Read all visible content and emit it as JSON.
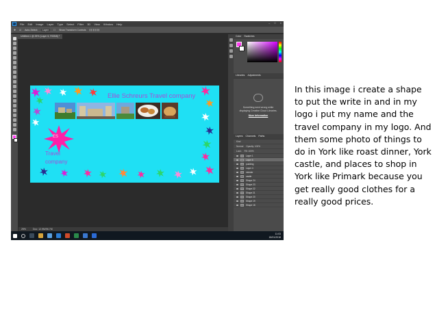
{
  "screenshot": {
    "menu_items": [
      "File",
      "Edit",
      "Image",
      "Layer",
      "Type",
      "Select",
      "Filter",
      "3D",
      "View",
      "Window",
      "Help"
    ],
    "options": {
      "auto_select": "Auto-Select:",
      "layer_value": "Layer",
      "show_transform": "Show Transform Controls"
    },
    "doc_tab": "Untitled-1 @ 25% (Layer 6, RGB/8) *",
    "status": {
      "zoom": "25%",
      "doc_info": "Doc: 12.9M/96.7M"
    },
    "canvas": {
      "company_title": "Ellie Schreurs Travel company",
      "logo_initials": "ES",
      "logo_line1": "Travel",
      "logo_line2": "company",
      "background_color": "#1fe0f4",
      "text_color": "#a64dd9"
    },
    "panels": {
      "color_tabs": [
        "Color",
        "Swatches"
      ],
      "adjust_tabs": [
        "Libraries",
        "Adjustments"
      ],
      "adjust_message": "Something went wrong while displaying Creative Cloud Libraries.",
      "adjust_link": "More Information",
      "layers_tabs": [
        "Layers",
        "Channels",
        "Paths"
      ],
      "layers_kind": "Kind",
      "blend_mode": "Normal",
      "opacity": "Opacity: 100%",
      "lock": "Lock:",
      "fill": "Fill: 100%",
      "layers": [
        "Layer 1",
        "Layer 6",
        "pudding",
        "Layer 4",
        "minster",
        "castle",
        "Shape 24",
        "Shape 23",
        "Shape 22",
        "Shape 21",
        "Shape 20",
        "Shape 19",
        "Shape 18"
      ]
    },
    "taskbar": {
      "time": "11:03",
      "date": "18/01/2018"
    }
  },
  "caption": {
    "text": "In this image i create a shape to put the write in and in my  logo  i put my name and the travel company  in my logo. And them some photo of things to do in York like roast dinner, York castle, and places to shop in York like Primark because you get really good clothes for a really good prices."
  },
  "colors": {
    "foreground_swatch": "#ff3df0",
    "canvas_cyan": "#1fe0f4",
    "purple_text": "#a64dd9",
    "magenta_star": "#ff1fa8"
  }
}
